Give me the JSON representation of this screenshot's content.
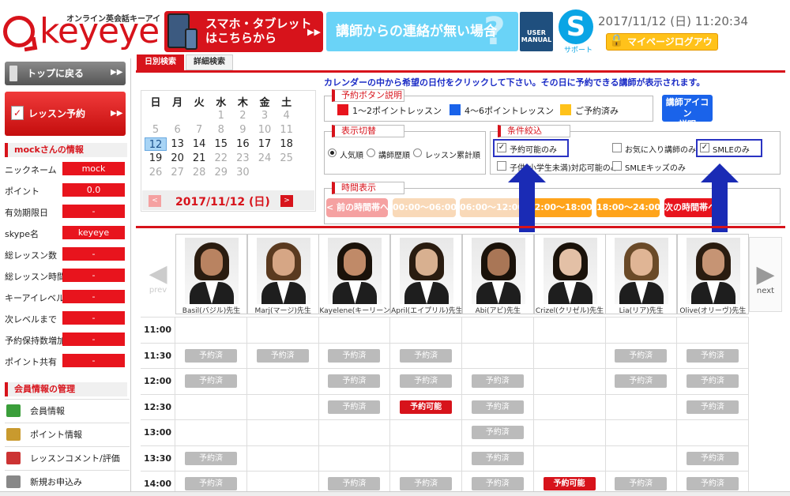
{
  "header": {
    "logo_word": "keyeye",
    "logo_sub": "オンライン英会話キーアイ",
    "smart_banner": [
      "スマホ・タブレット",
      "はこちらから"
    ],
    "contact_banner": "講師からの連絡が無い場合",
    "manual_label": [
      "USER",
      "MANUAL"
    ],
    "skype_glyph": "S",
    "skype_label": "サポート",
    "datetime": "2017/11/12 (日) 11:20:34",
    "logout_label": "マイページログアウト"
  },
  "sidebar": {
    "top_button": "トップに戻る",
    "lesson_button": "レッスン予約",
    "info_title": "mockさんの情報",
    "info_rows": [
      {
        "label": "ニックネーム",
        "value": "mock"
      },
      {
        "label": "ポイント",
        "value": "0.0"
      },
      {
        "label": "有効期限日",
        "value": "-"
      },
      {
        "label": "skype名",
        "value": "keyeye"
      },
      {
        "label": "総レッスン数",
        "value": "-"
      },
      {
        "label": "総レッスン時間",
        "value": "-"
      },
      {
        "label": "キーアイレベル",
        "value": "-"
      },
      {
        "label": "次レベルまで",
        "value": "-"
      },
      {
        "label": "予約保持数増加",
        "value": "-"
      },
      {
        "label": "ポイント共有",
        "value": "-"
      }
    ],
    "member_title": "会員情報の管理",
    "member_items": [
      "会員情報",
      "ポイント情報",
      "レッスンコメント/評価",
      "新規お申込み"
    ]
  },
  "tabs": [
    "日別検索",
    "詳細検索"
  ],
  "instruction": "カレンダーの中から希望の日付をクリックして下さい。その日に予約できる講師が表示されます。",
  "calendar": {
    "weekdays": [
      "日",
      "月",
      "火",
      "水",
      "木",
      "金",
      "土"
    ],
    "rows": [
      [
        "",
        "",
        "",
        "1",
        "2",
        "3",
        "4"
      ],
      [
        "5",
        "6",
        "7",
        "8",
        "9",
        "10",
        "11"
      ],
      [
        "12",
        "13",
        "14",
        "15",
        "16",
        "17",
        "18"
      ],
      [
        "19",
        "20",
        "21",
        "22",
        "23",
        "24",
        "25"
      ],
      [
        "26",
        "27",
        "28",
        "29",
        "30",
        "",
        ""
      ]
    ],
    "selected": "12",
    "selected_date": "2017/11/12 (日)",
    "prev_label": "<",
    "next_label": ">"
  },
  "legend": {
    "title": "予約ボタン説明",
    "items": [
      {
        "label": "1〜2ポイントレッスン",
        "color": "#e8141d"
      },
      {
        "label": "4〜6ポイントレッスン",
        "color": "#1a63ea"
      },
      {
        "label": "ご予約済み",
        "color": "#ffc21a"
      }
    ],
    "icon_button": [
      "講師アイコン",
      "説明"
    ]
  },
  "display": {
    "title": "表示切替",
    "options": [
      "人気順",
      "講師歴順",
      "レッスン累計順"
    ],
    "selected_index": 0
  },
  "filters": {
    "title": "条件絞込",
    "options": [
      {
        "label": "予約可能のみ",
        "checked": true,
        "highlight": true
      },
      {
        "label": "お気に入り講師のみ",
        "checked": false,
        "highlight": false
      },
      {
        "label": "SMLEのみ",
        "checked": true,
        "highlight": true
      },
      {
        "label": "子供(小学生未満)対応可能のみ",
        "checked": false,
        "highlight": false
      },
      {
        "label": "SMLEキッズのみ",
        "checked": false,
        "highlight": false
      }
    ],
    "check_glyph": "✓"
  },
  "time_display": {
    "title": "時間表示",
    "buttons": [
      {
        "label": "< 前の時間帯へ",
        "color": "#f5a1a1"
      },
      {
        "label": "00:00〜06:00",
        "color": "#f9d9b8"
      },
      {
        "label": "06:00〜12:00",
        "color": "#f9d9b8"
      },
      {
        "label": "12:00〜18:00",
        "color": "#ffa41b"
      },
      {
        "label": "18:00〜24:00",
        "color": "#ffa41b"
      },
      {
        "label": "次の時間帯へ >",
        "color": "#e8141d"
      }
    ]
  },
  "nav": {
    "prev": "prev",
    "next": "next"
  },
  "teachers": [
    "Basil(バジル)先生",
    "Marj(マージ)先生",
    "Kayelene(キーリーン)先生",
    "April(エイプリル)先生",
    "Abi(アビ)先生",
    "Crizel(クリゼル)先生",
    "Lia(リア)先生",
    "Olive(オリーヴ)先生"
  ],
  "status_labels": {
    "done": "予約済",
    "open": "予約可能"
  },
  "schedule": [
    {
      "time": "11:00",
      "slots": [
        "",
        "",
        "",
        "",
        "",
        "",
        "",
        ""
      ]
    },
    {
      "time": "11:30",
      "slots": [
        "done",
        "done",
        "done",
        "done",
        "",
        "",
        "done",
        "done"
      ]
    },
    {
      "time": "12:00",
      "slots": [
        "done",
        "",
        "done",
        "done",
        "done",
        "",
        "done",
        "done"
      ]
    },
    {
      "time": "12:30",
      "slots": [
        "",
        "",
        "done",
        "open",
        "done",
        "",
        "",
        "done"
      ]
    },
    {
      "time": "13:00",
      "slots": [
        "",
        "",
        "",
        "",
        "done",
        "",
        "",
        ""
      ]
    },
    {
      "time": "13:30",
      "slots": [
        "done",
        "",
        "",
        "",
        "done",
        "",
        "",
        "done"
      ]
    },
    {
      "time": "14:00",
      "slots": [
        "done",
        "",
        "done",
        "done",
        "done",
        "open",
        "done",
        "done"
      ]
    }
  ]
}
